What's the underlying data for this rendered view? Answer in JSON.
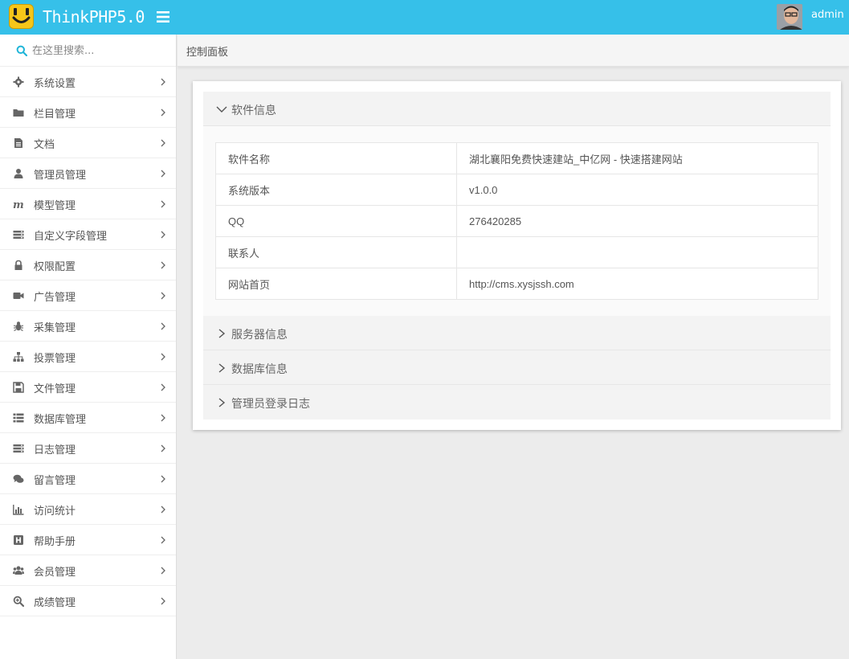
{
  "header": {
    "brand": "ThinkPHP5.0",
    "username": "admin",
    "bar_color": "#36c0e9"
  },
  "sidebar": {
    "search_placeholder": "在这里搜索...",
    "items": [
      {
        "label": "系统设置",
        "icon": "gear-icon"
      },
      {
        "label": "栏目管理",
        "icon": "folder-icon"
      },
      {
        "label": "文档",
        "icon": "file-icon"
      },
      {
        "label": "管理员管理",
        "icon": "user-icon"
      },
      {
        "label": "模型管理",
        "icon": "m-icon"
      },
      {
        "label": "自定义字段管理",
        "icon": "fields-icon"
      },
      {
        "label": "权限配置",
        "icon": "lock-icon"
      },
      {
        "label": "广告管理",
        "icon": "video-icon"
      },
      {
        "label": "采集管理",
        "icon": "bug-icon"
      },
      {
        "label": "投票管理",
        "icon": "sitemap-icon"
      },
      {
        "label": "文件管理",
        "icon": "save-icon"
      },
      {
        "label": "数据库管理",
        "icon": "list-icon"
      },
      {
        "label": "日志管理",
        "icon": "server-icon"
      },
      {
        "label": "留言管理",
        "icon": "comments-icon"
      },
      {
        "label": "访问统计",
        "icon": "bar-chart-icon"
      },
      {
        "label": "帮助手册",
        "icon": "h-square-icon"
      },
      {
        "label": "会员管理",
        "icon": "users-icon"
      },
      {
        "label": "成绩管理",
        "icon": "zoom-icon"
      }
    ]
  },
  "breadcrumb": "控制面板",
  "panel": {
    "software_title": "软件信息",
    "rows": [
      {
        "key": "软件名称",
        "value": "湖北襄阳免费快速建站_中亿网 - 快速搭建网站"
      },
      {
        "key": "系统版本",
        "value": "v1.0.0"
      },
      {
        "key": "QQ",
        "value": "276420285"
      },
      {
        "key": "联系人",
        "value": ""
      },
      {
        "key": "网站首页",
        "value": "http://cms.xysjssh.com"
      }
    ],
    "server_title": "服务器信息",
    "database_title": "数据库信息",
    "login_log_title": "管理员登录日志"
  }
}
